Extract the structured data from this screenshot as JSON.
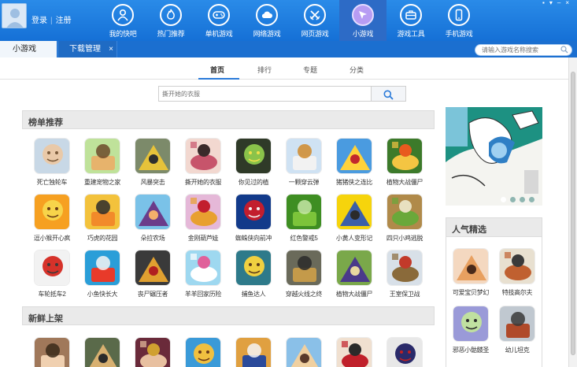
{
  "top_bar": {
    "login": "登录",
    "register": "注册",
    "nav": [
      {
        "label": "我的快吧",
        "icon": "user-icon"
      },
      {
        "label": "热门推荐",
        "icon": "flame-icon"
      },
      {
        "label": "单机游戏",
        "icon": "gamepad-icon"
      },
      {
        "label": "网络游戏",
        "icon": "cloud-icon"
      },
      {
        "label": "网页游戏",
        "icon": "swords-icon"
      },
      {
        "label": "小游戏",
        "icon": "cursor-icon",
        "active": true
      },
      {
        "label": "游戏工具",
        "icon": "toolbox-icon"
      },
      {
        "label": "手机游戏",
        "icon": "phone-icon"
      }
    ]
  },
  "tabs": {
    "active": "小游戏",
    "second": "下载管理",
    "close": "×"
  },
  "top_search": {
    "placeholder": "请输入游戏名称搜索"
  },
  "subnav": [
    "首页",
    "排行",
    "专题",
    "分类"
  ],
  "search": {
    "placeholder": "撕开她的衣服"
  },
  "sections": {
    "ranking": "榜单推荐",
    "fresh": "新鲜上架",
    "popular": "人气精选"
  },
  "ranking_games": [
    "死亡独轮车",
    "重建宠物之家",
    "风暴突击",
    "撕开她的衣服",
    "你见过的植",
    "一颗穿云弹",
    "猪猪侠之连比",
    "植物大战僵尸",
    "逗小猴开心疯",
    "巧虎的花园",
    "朵拉农场",
    "金刚葫芦娃",
    "蜘蛛侠向前冲",
    "红色警戒5",
    "小黄人变形记",
    "四只小鸡逃脱",
    "车轮抵车2",
    "小鱼快长大",
    "丧尸碾压者",
    "羊羊回家历险",
    "捕鱼达人",
    "穿越火线之终",
    "植物大战僵尸",
    "王室保卫战"
  ],
  "popular_games": [
    "可爱宝贝梦幻",
    "特技高尔夫",
    "邪恶小骷髅圣",
    "幼儿坦克"
  ],
  "colors": {
    "topbar": "#1b75da",
    "tabstrip": "#1b6fd0",
    "active_nav": "#2d6bc6",
    "accent": "#2a7ad9"
  }
}
